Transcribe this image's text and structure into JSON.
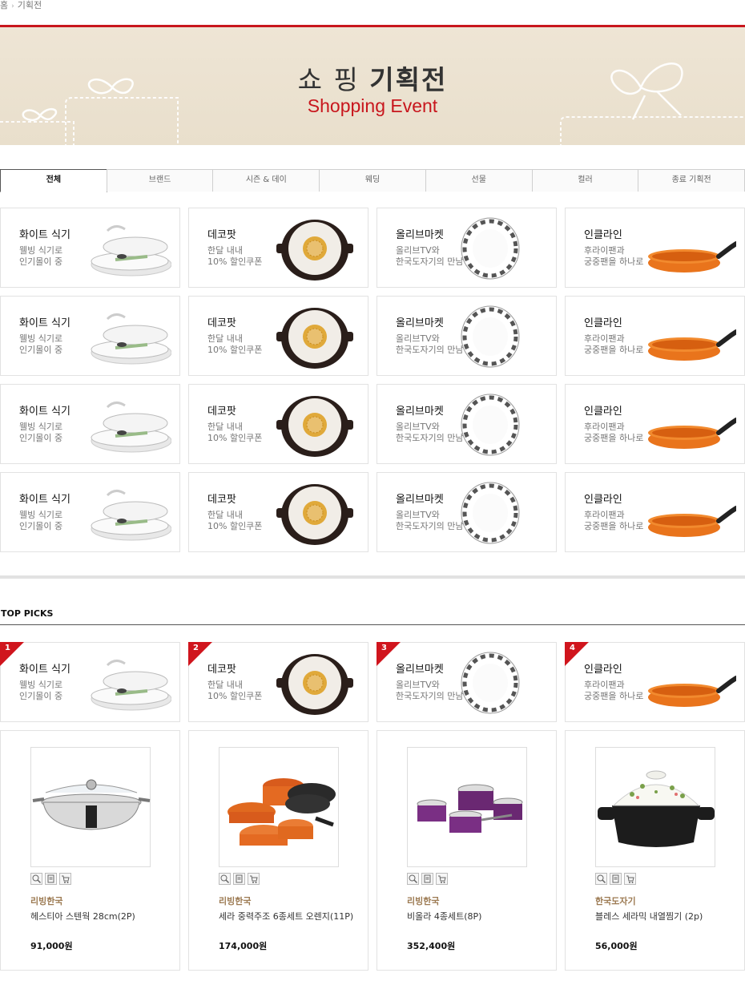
{
  "breadcrumb": {
    "home": "홈",
    "current": "기획전"
  },
  "banner": {
    "title_light": "쇼 핑 ",
    "title_bold": "기획전",
    "subtitle": "Shopping Event"
  },
  "tabs": [
    "전체",
    "브랜드",
    "시즌 & 데이",
    "웨딩",
    "선물",
    "컬러",
    "종료 기획전"
  ],
  "cards": [
    {
      "title": "화이트 식기",
      "line1": "웰빙 식기로",
      "line2": "인기몰이 중",
      "icon": "white-dish-icon"
    },
    {
      "title": "데코팟",
      "line1": "한달 내내",
      "line2": "10% 할인쿠폰",
      "icon": "deco-pot-icon"
    },
    {
      "title": "올리브마켓",
      "line1": "올리브TV와",
      "line2": "한국도자기의 만남",
      "icon": "plate-icon"
    },
    {
      "title": "인클라인",
      "line1": "후라이팬과",
      "line2": "궁중팬을 하나로",
      "icon": "frying-pan-icon"
    }
  ],
  "top_picks": {
    "title": "TOP PICKS",
    "ranks": [
      "1",
      "2",
      "3",
      "4"
    ]
  },
  "products": [
    {
      "brand": "리빙한국",
      "name": "헤스티아 스텐웍 28cm(2P)",
      "price": "91,000원",
      "icon": "stainless-wok-icon"
    },
    {
      "brand": "리빙한국",
      "name": "세라 중력주조 6종세트 오렌지(11P)",
      "price": "174,000원",
      "icon": "orange-cookware-set-icon"
    },
    {
      "brand": "리빙한국",
      "name": "비올라 4종세트(8P)",
      "price": "352,400원",
      "icon": "purple-pot-set-icon"
    },
    {
      "brand": "한국도자기",
      "name": "블레스 세라믹 내열찜기 (2p)",
      "price": "56,000원",
      "icon": "ceramic-steamer-icon"
    }
  ],
  "colors": {
    "accent": "#c8161d",
    "brand_text": "#9c7a52",
    "banner_bg": "#eee5d5"
  }
}
